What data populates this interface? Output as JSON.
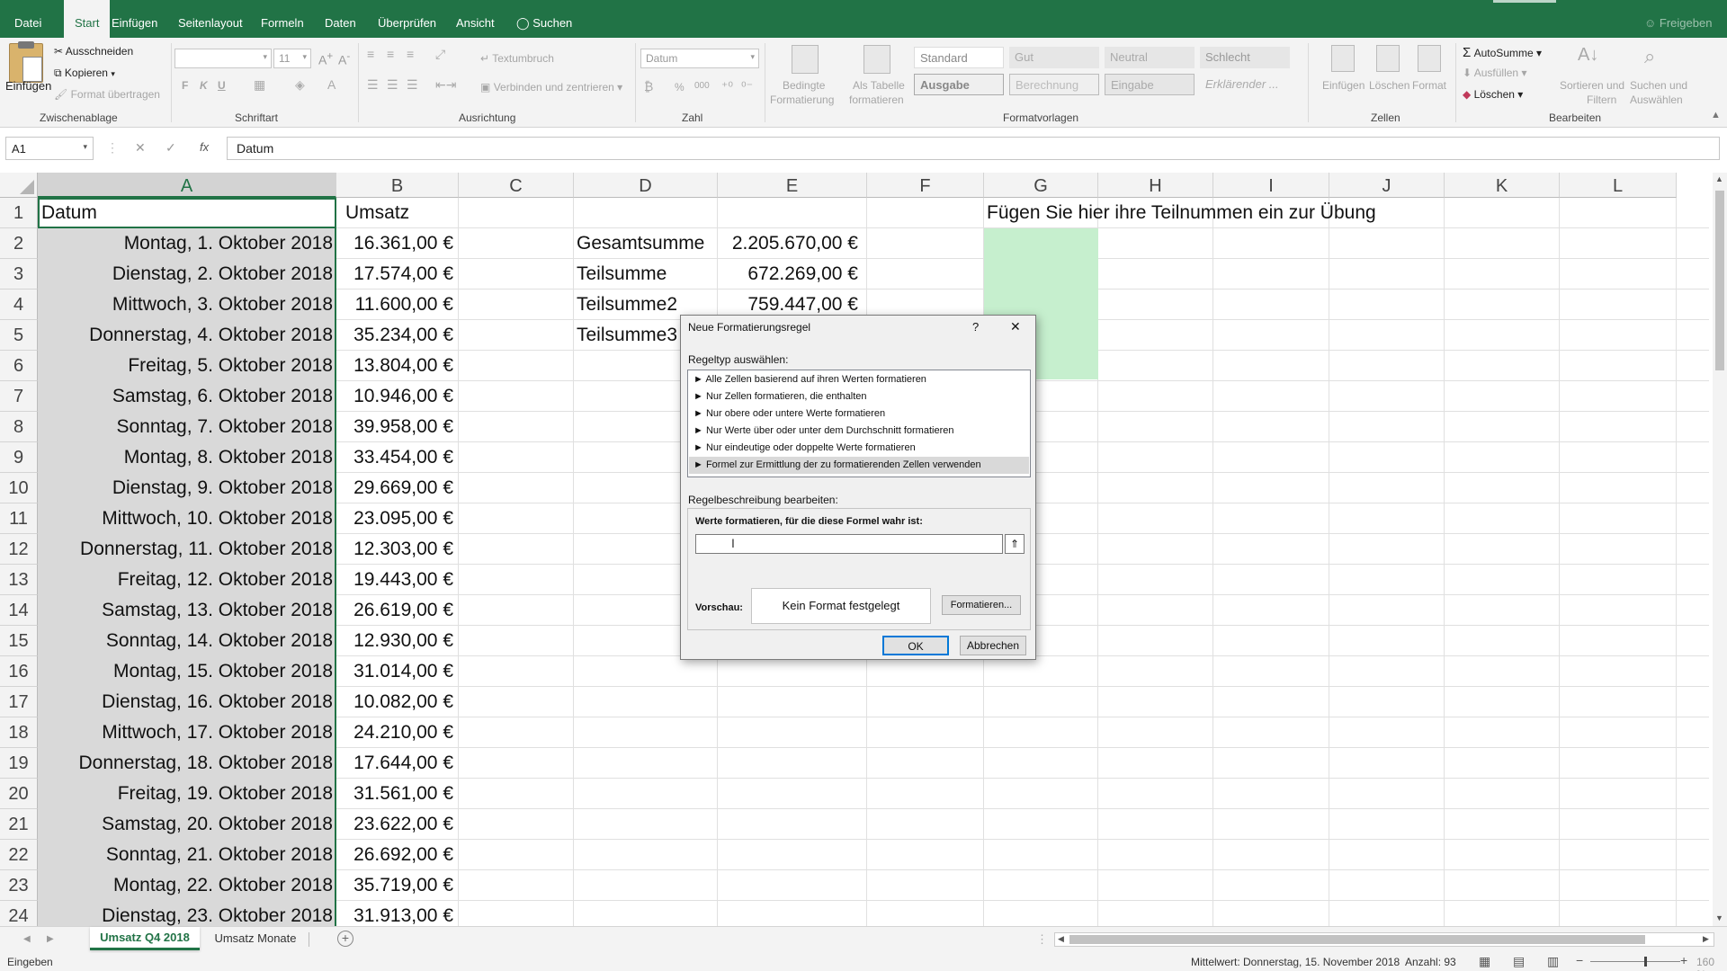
{
  "tabs": [
    "Datei",
    "Start",
    "Einfügen",
    "Seitenlayout",
    "Formeln",
    "Daten",
    "Überprüfen",
    "Ansicht"
  ],
  "search_label": "Suchen",
  "share_label": "Freigeben",
  "ribbon": {
    "clipboard": {
      "paste": "Einfügen",
      "cut": "Ausschneiden",
      "copy": "Kopieren",
      "format_painter": "Format übertragen",
      "group": "Zwischenablage"
    },
    "font": {
      "font_name": "",
      "font_size": "11",
      "bold": "F",
      "italic": "K",
      "underline": "U",
      "group": "Schriftart"
    },
    "alignment": {
      "wrap": "Textumbruch",
      "merge": "Verbinden und zentrieren",
      "group": "Ausrichtung"
    },
    "number": {
      "format": "Datum",
      "percent": "%",
      "thousands": "000",
      "group": "Zahl"
    },
    "cond": {
      "line1": "Bedingte",
      "line2": "Formatierung"
    },
    "astable": {
      "line1": "Als Tabelle",
      "line2": "formatieren"
    },
    "styles": {
      "standard": "Standard",
      "gut": "Gut",
      "neutral": "Neutral",
      "schlecht": "Schlecht",
      "ausgabe": "Ausgabe",
      "berechnung": "Berechnung",
      "eingabe": "Eingabe",
      "erklaerend": "Erklärender ...",
      "group": "Formatvorlagen"
    },
    "cells": {
      "insert": "Einfügen",
      "delete": "Löschen",
      "format": "Format",
      "group": "Zellen"
    },
    "editing": {
      "autosum": "AutoSumme",
      "fill": "Ausfüllen",
      "clear": "Löschen",
      "sort1": "Sortieren und",
      "sort2": "Filtern",
      "find1": "Suchen und",
      "find2": "Auswählen",
      "group": "Bearbeiten"
    }
  },
  "namebox": "A1",
  "formula": "Datum",
  "fx": "fx",
  "columns": [
    "A",
    "B",
    "C",
    "D",
    "E",
    "F",
    "G",
    "H",
    "I",
    "J",
    "K",
    "L"
  ],
  "rows": [
    "1",
    "2",
    "3",
    "4",
    "5",
    "6",
    "7",
    "8",
    "9",
    "10",
    "11",
    "12",
    "13",
    "14",
    "15",
    "16",
    "17",
    "18",
    "19",
    "20",
    "21",
    "22",
    "23",
    "24"
  ],
  "colA": [
    "Datum",
    "Montag, 1. Oktober 2018",
    "Dienstag, 2. Oktober 2018",
    "Mittwoch, 3. Oktober 2018",
    "Donnerstag, 4. Oktober 2018",
    "Freitag, 5. Oktober 2018",
    "Samstag, 6. Oktober 2018",
    "Sonntag, 7. Oktober 2018",
    "Montag, 8. Oktober 2018",
    "Dienstag, 9. Oktober 2018",
    "Mittwoch, 10. Oktober 2018",
    "Donnerstag, 11. Oktober 2018",
    "Freitag, 12. Oktober 2018",
    "Samstag, 13. Oktober 2018",
    "Sonntag, 14. Oktober 2018",
    "Montag, 15. Oktober 2018",
    "Dienstag, 16. Oktober 2018",
    "Mittwoch, 17. Oktober 2018",
    "Donnerstag, 18. Oktober 2018",
    "Freitag, 19. Oktober 2018",
    "Samstag, 20. Oktober 2018",
    "Sonntag, 21. Oktober 2018",
    "Montag, 22. Oktober 2018",
    "Dienstag, 23. Oktober 2018"
  ],
  "colB": [
    "Umsatz",
    "16.361,00 €",
    "17.574,00 €",
    "11.600,00 €",
    "35.234,00 €",
    "13.804,00 €",
    "10.946,00 €",
    "39.958,00 €",
    "33.454,00 €",
    "29.669,00 €",
    "23.095,00 €",
    "12.303,00 €",
    "19.443,00 €",
    "26.619,00 €",
    "12.930,00 €",
    "31.014,00 €",
    "10.082,00 €",
    "24.210,00 €",
    "17.644,00 €",
    "31.561,00 €",
    "23.622,00 €",
    "26.692,00 €",
    "35.719,00 €",
    "31.913,00 €"
  ],
  "summary": [
    {
      "label": "Gesamtsumme",
      "value": "2.205.670,00 €"
    },
    {
      "label": "Teilsumme",
      "value": "672.269,00 €"
    },
    {
      "label": "Teilsumme2",
      "value": "759.447,00 €"
    },
    {
      "label": "Teilsumme3",
      "value": ""
    }
  ],
  "instruction": "Fügen Sie hier ihre Teilnummen ein zur Übung",
  "dialog": {
    "title": "Neue Formatierungsregel",
    "help": "?",
    "close": "✕",
    "ruletype_label": "Regeltyp auswählen:",
    "rules": [
      "► Alle Zellen basierend auf ihren Werten formatieren",
      "► Nur Zellen formatieren, die enthalten",
      "► Nur obere oder untere Werte formatieren",
      "► Nur Werte über oder unter dem Durchschnitt formatieren",
      "► Nur eindeutige oder doppelte Werte formatieren",
      "► Formel zur Ermittlung der zu formatierenden Zellen verwenden"
    ],
    "selected_rule": 5,
    "desc_label": "Regelbeschreibung bearbeiten:",
    "formula_label": "Werte formatieren, für die diese Formel wahr ist:",
    "formula_value": "",
    "preview_label": "Vorschau:",
    "preview_text": "Kein Format festgelegt",
    "format_button": "Formatieren...",
    "ok": "OK",
    "cancel": "Abbrechen"
  },
  "sheets": [
    "Umsatz Q4 2018",
    "Umsatz Monate"
  ],
  "active_sheet": 0,
  "status": {
    "mode": "Eingeben",
    "average": "Mittelwert: Donnerstag, 15. November 2018",
    "count": "Anzahl: 93",
    "zoom": "160 %"
  },
  "colors": {
    "excel_green": "#217346",
    "highlight_green": "#c6efce",
    "selection_gray": "#d9d9d9"
  }
}
